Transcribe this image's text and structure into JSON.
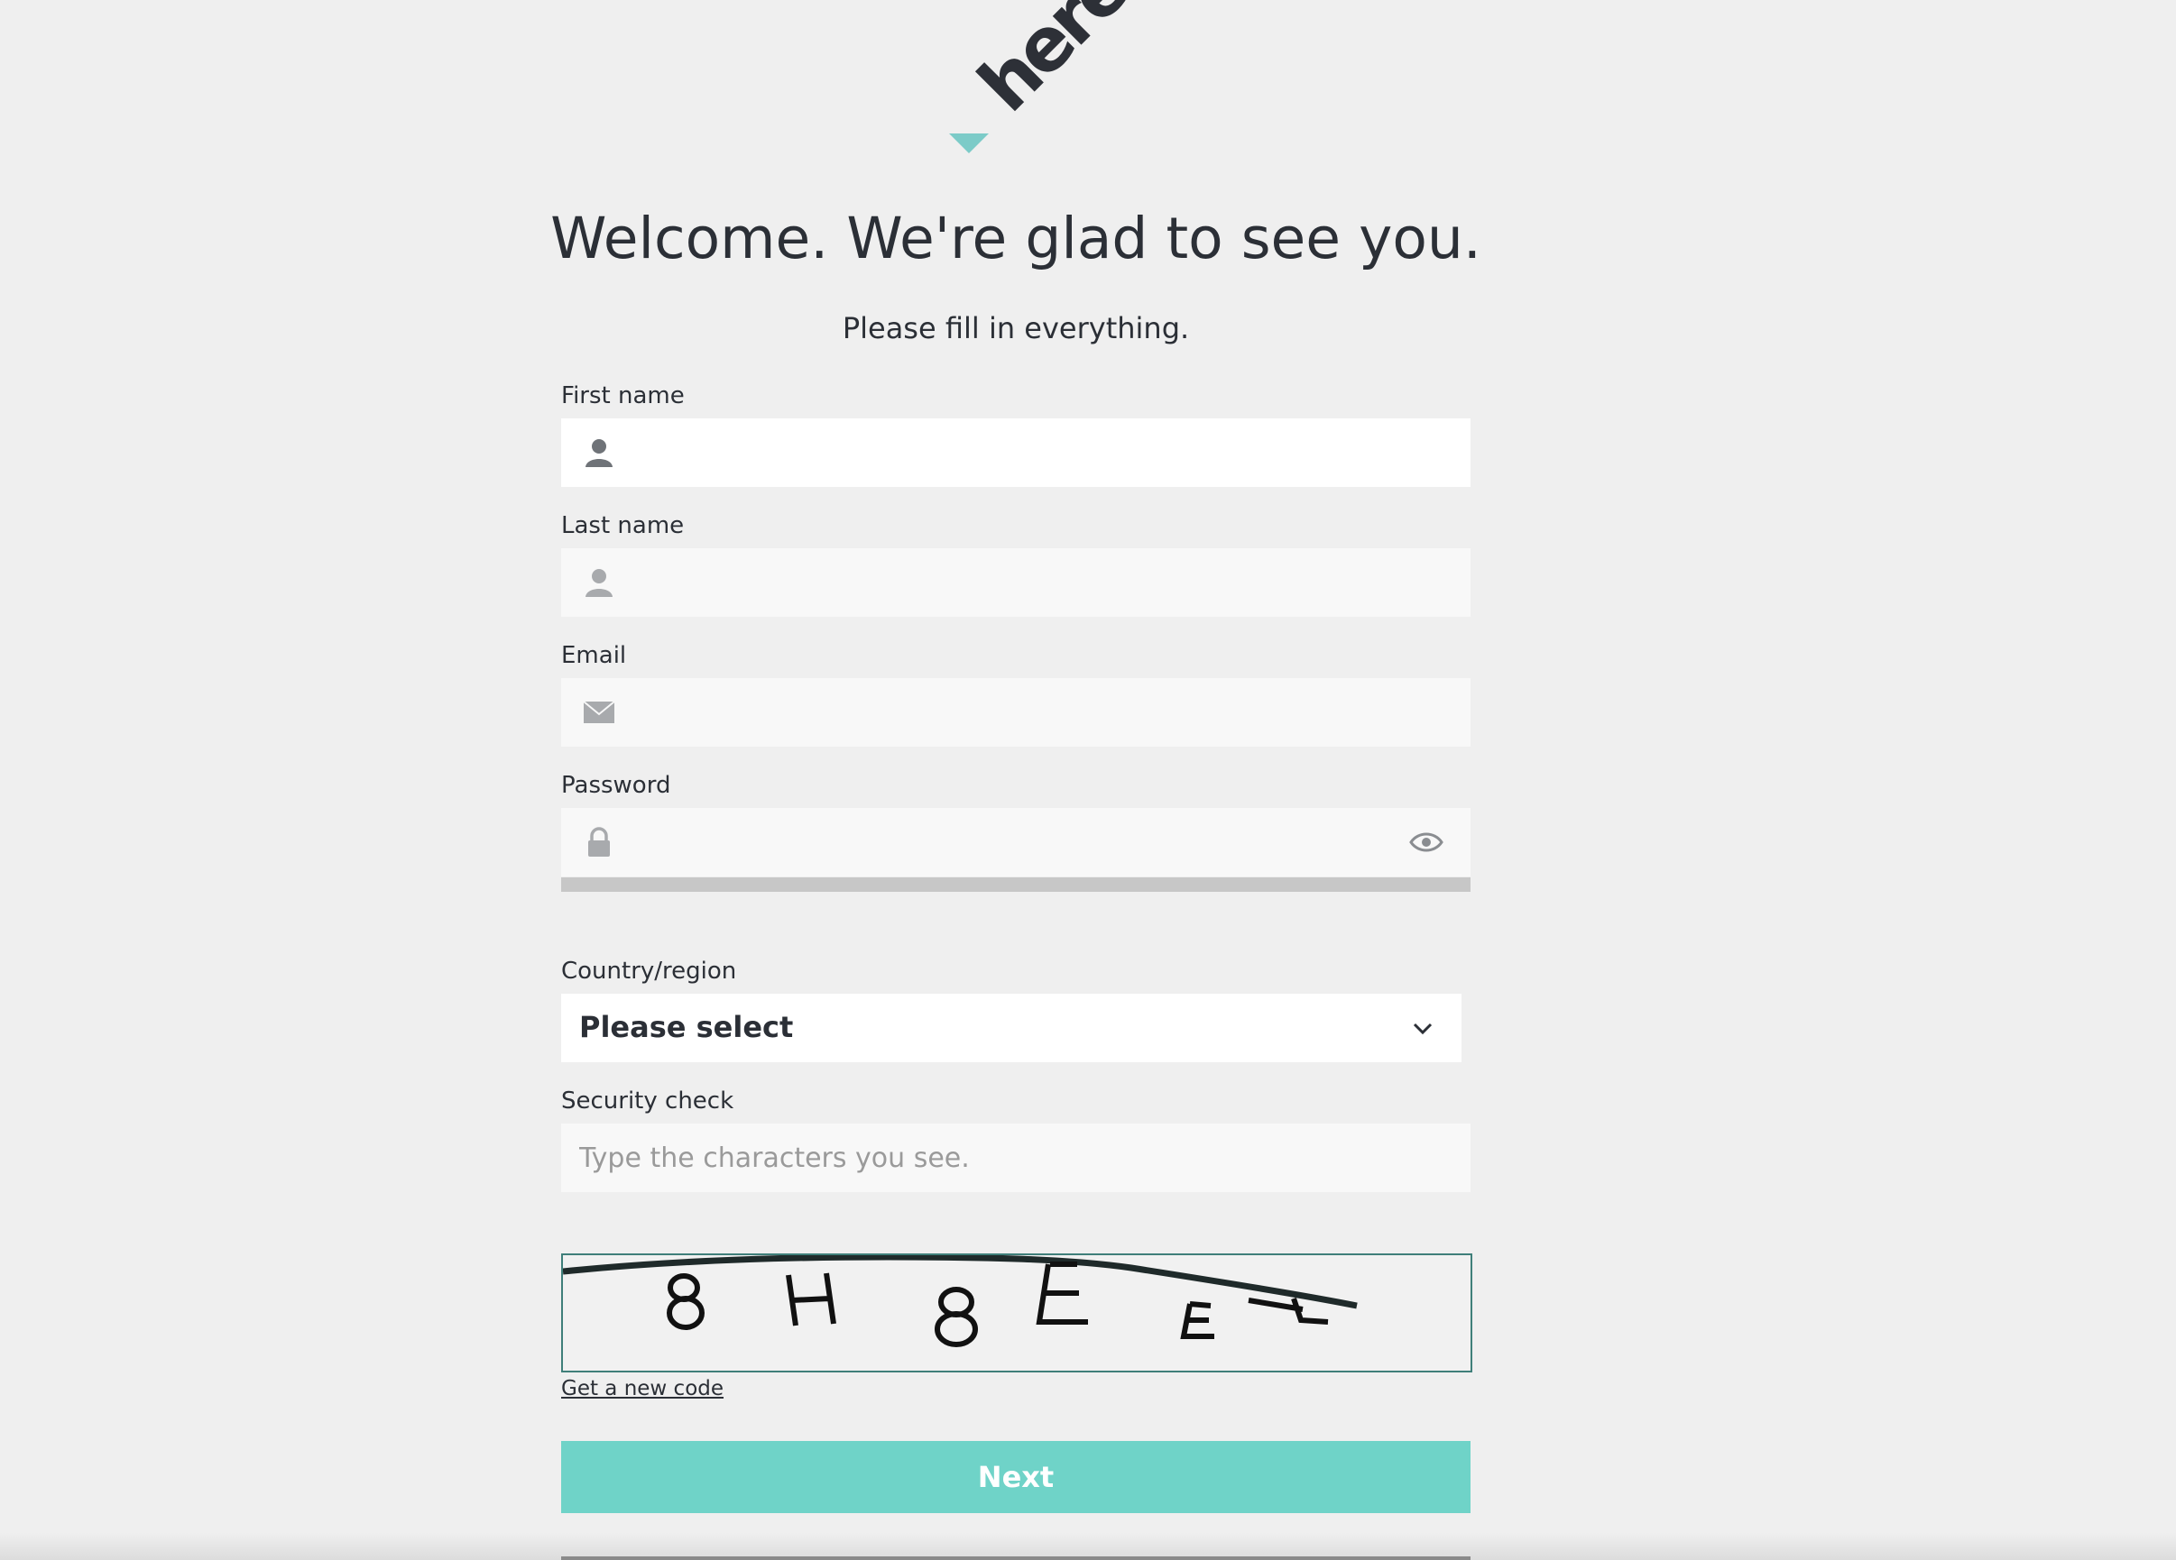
{
  "brand": {
    "logo_text": "here",
    "accent": "#6fd3c8"
  },
  "header": {
    "title": "Welcome. We're glad to see you.",
    "subtitle": "Please fill in everything."
  },
  "form": {
    "first_name": {
      "label": "First name",
      "value": "",
      "icon": "person-icon"
    },
    "last_name": {
      "label": "Last name",
      "value": "",
      "icon": "person-icon"
    },
    "email": {
      "label": "Email",
      "value": "",
      "icon": "envelope-icon"
    },
    "password": {
      "label": "Password",
      "value": "",
      "icon": "lock-icon",
      "toggle_icon": "eye-icon"
    },
    "country": {
      "label": "Country/region",
      "selected": "Please select",
      "icon": "chevron-down-icon"
    },
    "security": {
      "label": "Security check",
      "placeholder": "Type the characters you see.",
      "value": "",
      "new_code_link": "Get a new code"
    },
    "next_label": "Next"
  }
}
